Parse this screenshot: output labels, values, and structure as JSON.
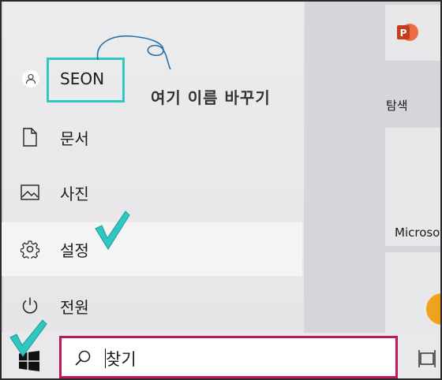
{
  "start_menu": {
    "user": {
      "name": "SEON"
    },
    "items": [
      {
        "label": "문서",
        "icon": "document-icon"
      },
      {
        "label": "사진",
        "icon": "pictures-icon"
      },
      {
        "label": "설정",
        "icon": "gear-icon"
      },
      {
        "label": "전원",
        "icon": "power-icon"
      }
    ]
  },
  "annotation": {
    "text": "여기 이름 바꾸기"
  },
  "tiles": [
    {
      "label": "탐색",
      "icon": "powerpoint-icon"
    },
    {
      "label": "Microsoft"
    }
  ],
  "taskbar": {
    "search": {
      "label": "찾기"
    }
  },
  "colors": {
    "annotation_box": "#2ec7c2",
    "check_mark": "#2ec7c2",
    "search_outline": "#c0185c",
    "powerpoint": "#c43e1c"
  }
}
